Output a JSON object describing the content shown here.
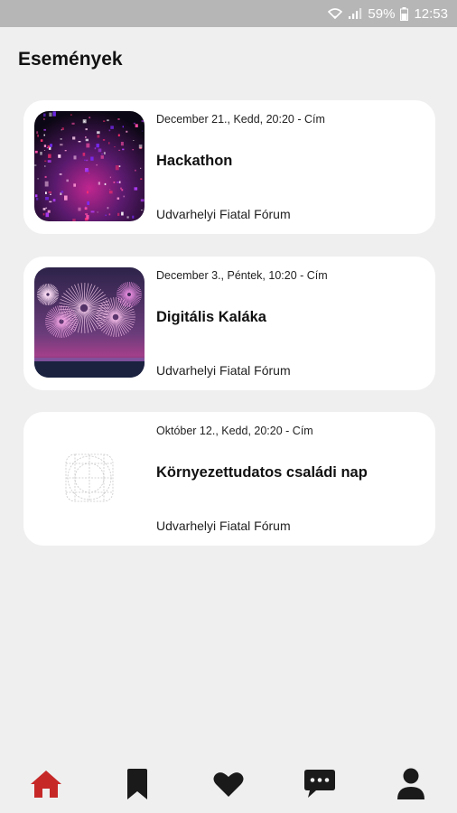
{
  "status_bar": {
    "battery": "59%",
    "time": "12:53"
  },
  "page": {
    "title": "Események"
  },
  "events": [
    {
      "date": "December 21., Kedd, 20:20 - Cím",
      "title": "Hackathon",
      "organizer": "Udvarhelyi Fiatal Fórum",
      "image": "confetti-party-photo"
    },
    {
      "date": "December 3., Péntek, 10:20 - Cím",
      "title": "Digitális Kaláka",
      "organizer": "Udvarhelyi Fiatal Fórum",
      "image": "fireworks-photo"
    },
    {
      "date": "Október 12., Kedd, 20:20 - Cím",
      "title": "Környezettudatos családi nap",
      "organizer": "Udvarhelyi Fiatal Fórum",
      "image": "placeholder-icon"
    }
  ],
  "bottom_nav": {
    "items": [
      {
        "icon": "home-icon",
        "active": true
      },
      {
        "icon": "bookmark-icon",
        "active": false
      },
      {
        "icon": "heart-icon",
        "active": false
      },
      {
        "icon": "chat-icon",
        "active": false
      },
      {
        "icon": "profile-icon",
        "active": false
      }
    ],
    "active_color": "#c62828",
    "inactive_color": "#1a1a1a"
  }
}
